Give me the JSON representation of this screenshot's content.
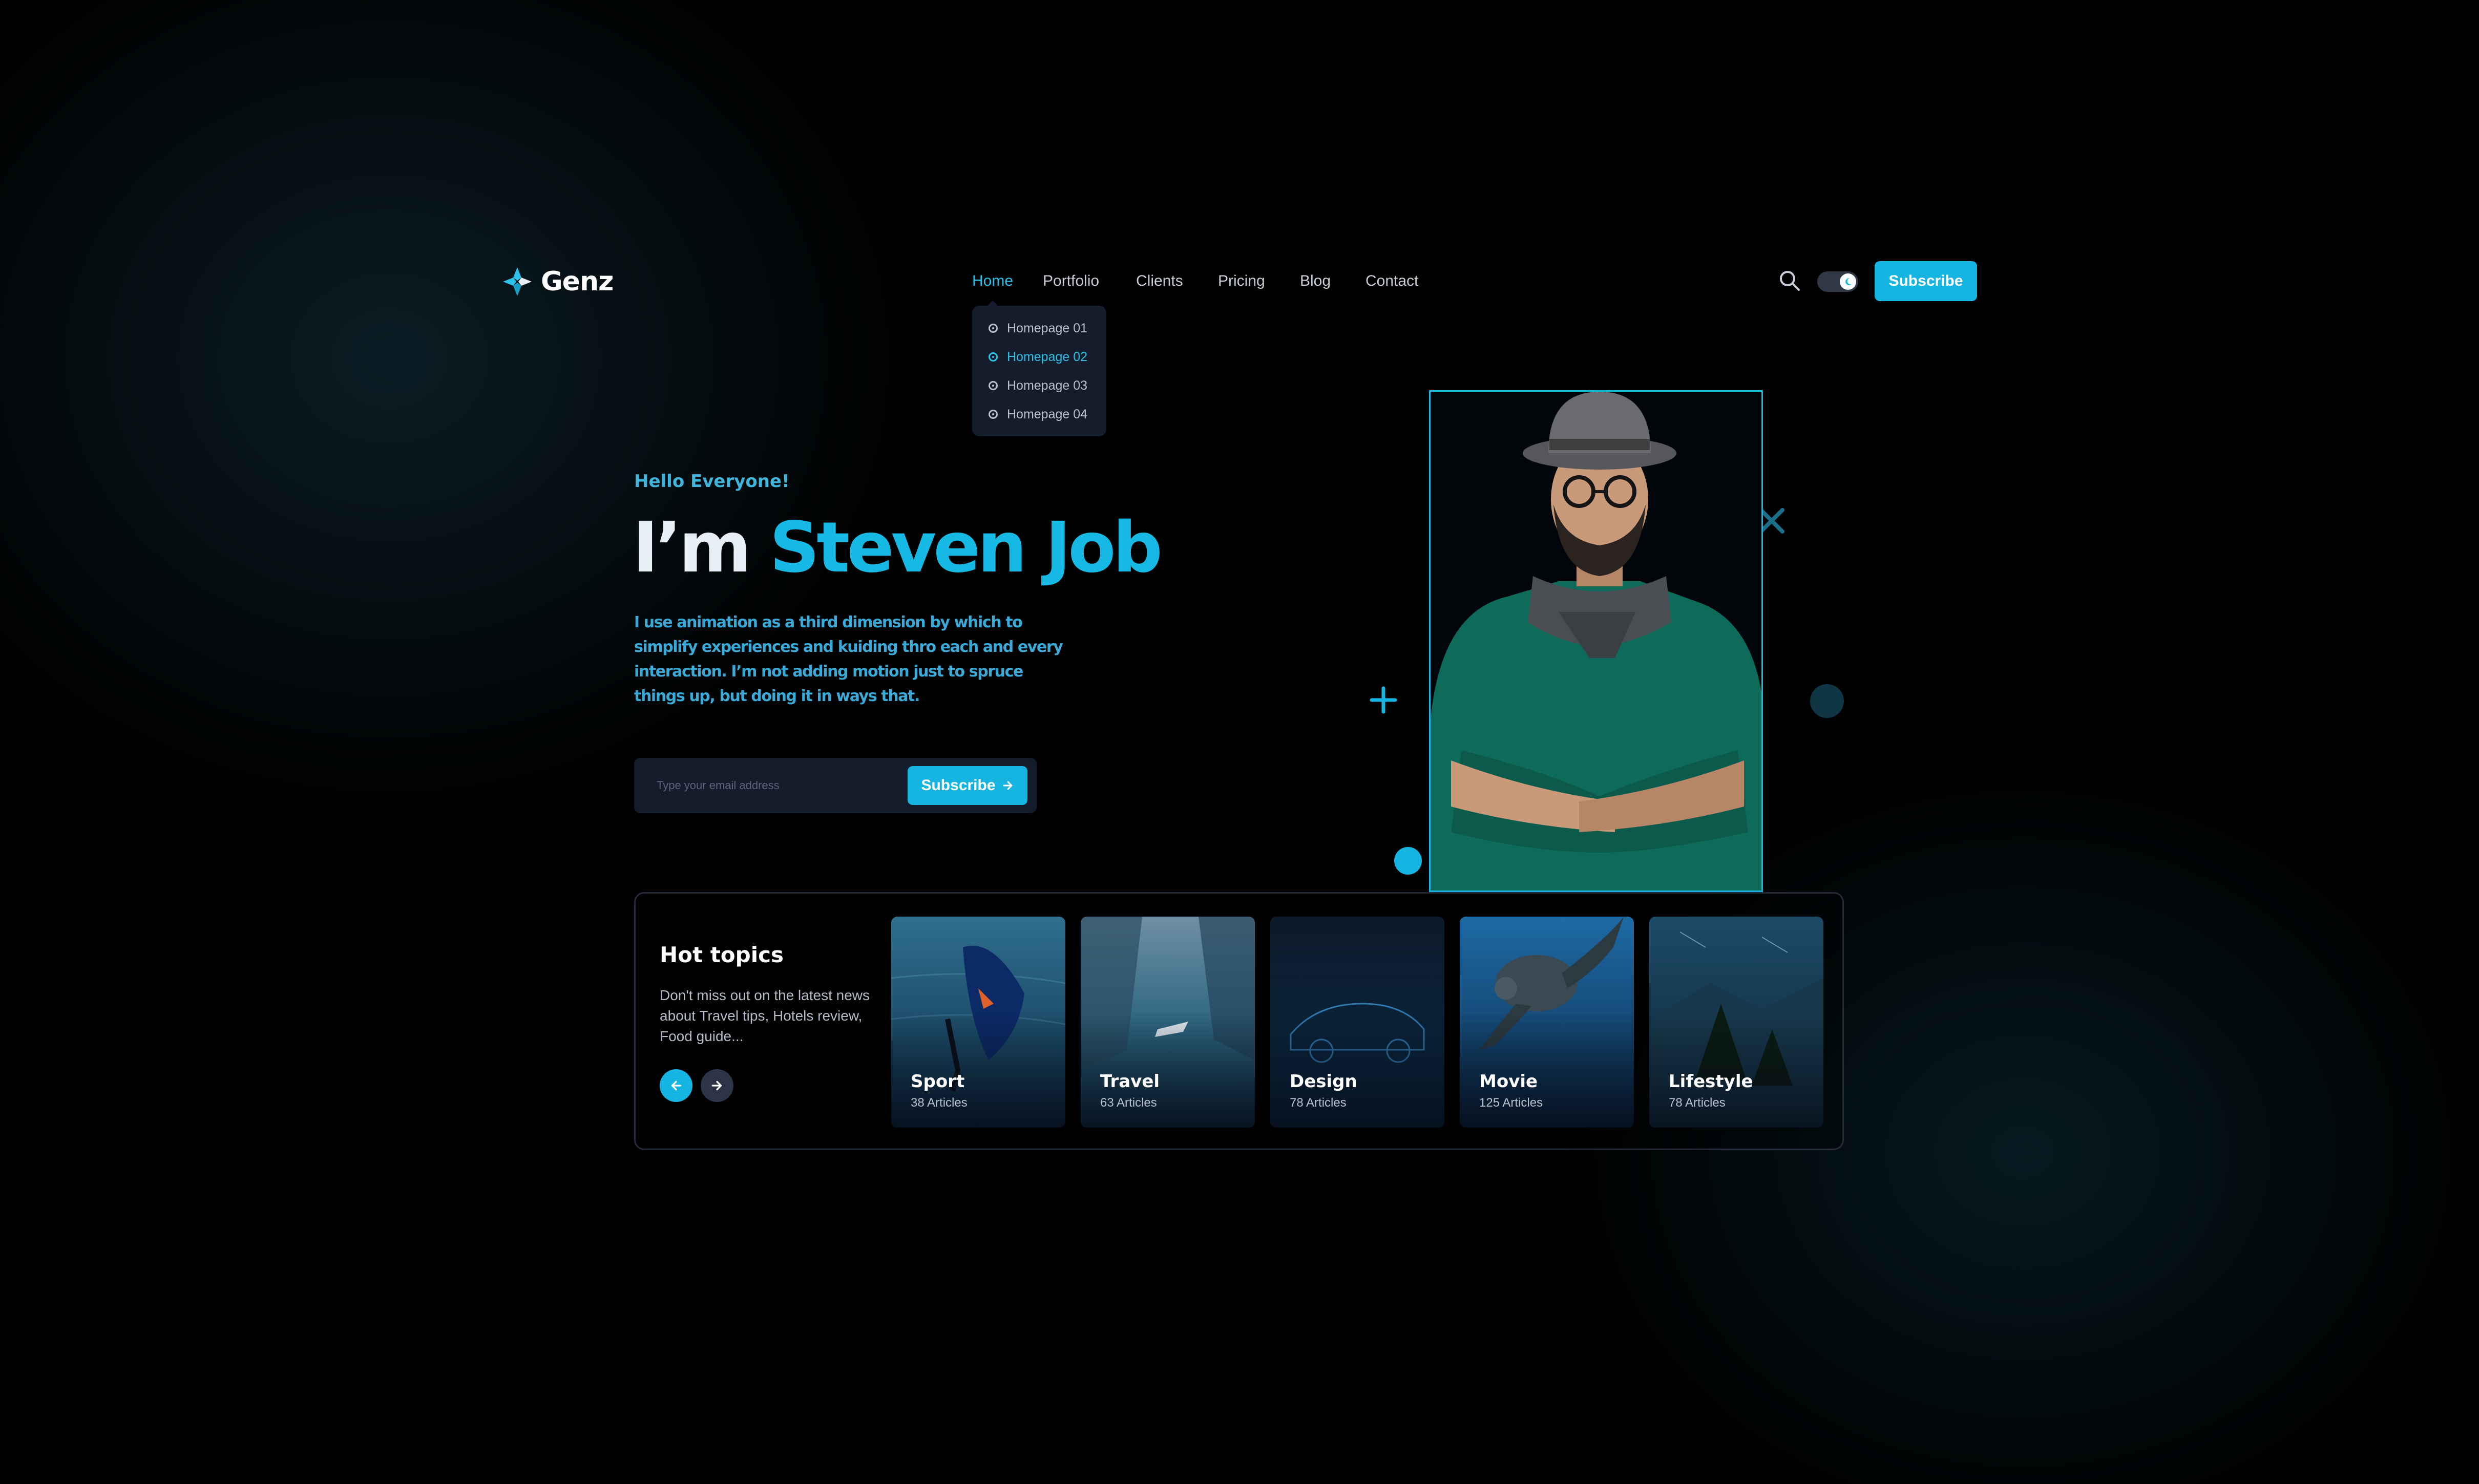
{
  "brand": {
    "name": "Genz",
    "accent": "#16b4e0"
  },
  "nav": {
    "items": [
      {
        "label": "Home",
        "active": true
      },
      {
        "label": "Portfolio"
      },
      {
        "label": "Clients"
      },
      {
        "label": "Pricing"
      },
      {
        "label": "Blog"
      },
      {
        "label": "Contact"
      }
    ],
    "dropdown": [
      {
        "label": "Homepage 01"
      },
      {
        "label": "Homepage 02",
        "active": true
      },
      {
        "label": "Homepage 03"
      },
      {
        "label": "Homepage 04"
      }
    ]
  },
  "header": {
    "search_icon": "search-icon",
    "theme_toggle": "dark-mode",
    "subscribe_label": "Subscribe"
  },
  "hero": {
    "greeting": "Hello Everyone!",
    "title_prefix": "I’m",
    "title_name": "Steven Job",
    "description": "I use animation as a third dimension by which to simplify experiences and kuiding thro each and every interaction. I’m not adding motion just to spruce things up, but doing it in ways that.",
    "email_placeholder": "Type your email address",
    "subscribe_label": "Subscribe"
  },
  "hot_topics": {
    "title": "Hot topics",
    "description": "Don't miss out on the latest news about Travel tips, Hotels review, Food guide...",
    "cards": [
      {
        "title": "Sport",
        "count": "38 Articles"
      },
      {
        "title": "Travel",
        "count": "63 Articles"
      },
      {
        "title": "Design",
        "count": "78 Articles"
      },
      {
        "title": "Movie",
        "count": "125 Articles"
      },
      {
        "title": "Lifestyle",
        "count": "78 Articles"
      }
    ]
  }
}
